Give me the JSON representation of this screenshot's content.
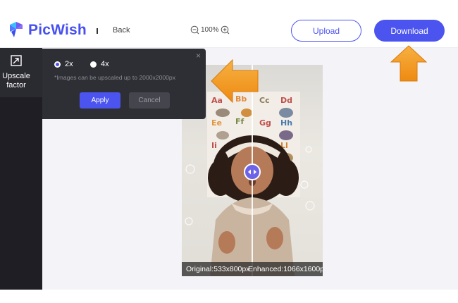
{
  "header": {
    "brand": "PicWish",
    "separator": "I",
    "back_label": "Back",
    "zoom_level": "100%",
    "upload_label": "Upload",
    "download_label": "Download"
  },
  "sidebar": {
    "tools": [
      {
        "label": "Upscale factor",
        "icon": "upscale-icon"
      }
    ]
  },
  "upscale_panel": {
    "options": [
      {
        "label": "2x",
        "selected": true
      },
      {
        "label": "4x",
        "selected": false
      }
    ],
    "note": "*Images can be upscaled up to 2000x2000px",
    "apply_label": "Apply",
    "cancel_label": "Cancel",
    "close_icon": "×"
  },
  "preview": {
    "original_caption": "Original:533x800px",
    "enhanced_caption": "Enhanced:1066x1600px"
  },
  "colors": {
    "accent": "#4c54f0",
    "annotation_arrow": "#f39a1a",
    "sidebar_bg": "#1e1e24",
    "panel_bg": "#2e2e35"
  }
}
